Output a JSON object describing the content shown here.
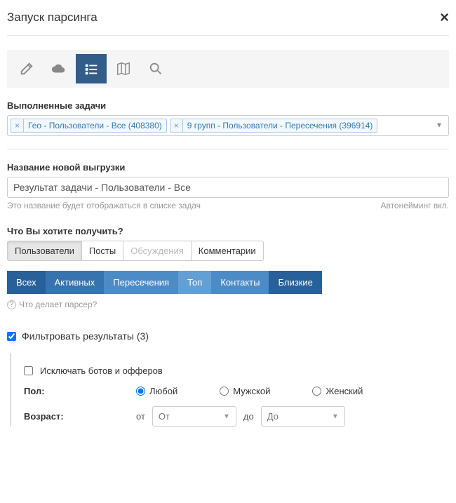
{
  "header": {
    "title": "Запуск парсинга"
  },
  "tasks": {
    "label": "Выполненные задачи",
    "tags": [
      "Гео - Пользователи - Все (408380)",
      "9 групп - Пользователи - Пересечения (396914)"
    ]
  },
  "export": {
    "label": "Название новой выгрузки",
    "value": "Результат задачи - Пользователи - Все",
    "hint": "Это название будет отображаться в списке задач",
    "autonaming": "Автонейминг вкл."
  },
  "what": {
    "label": "Что Вы хотите получить?",
    "options": [
      "Пользователи",
      "Посты",
      "Обсуждения",
      "Комментарии"
    ]
  },
  "scope": {
    "options": [
      "Всех",
      "Активных",
      "Пересечения",
      "Топ",
      "Контакты",
      "Близкие"
    ]
  },
  "parser_hint": "Что делает парсер?",
  "filter": {
    "label": "Фильтровать результаты (3)",
    "exclude_bots": "Исключать ботов и офферов",
    "gender": {
      "label": "Пол:",
      "any": "Любой",
      "male": "Мужской",
      "female": "Женский"
    },
    "age": {
      "label": "Возраст:",
      "from": "от",
      "from_placeholder": "От",
      "to": "до",
      "to_placeholder": "До"
    }
  }
}
